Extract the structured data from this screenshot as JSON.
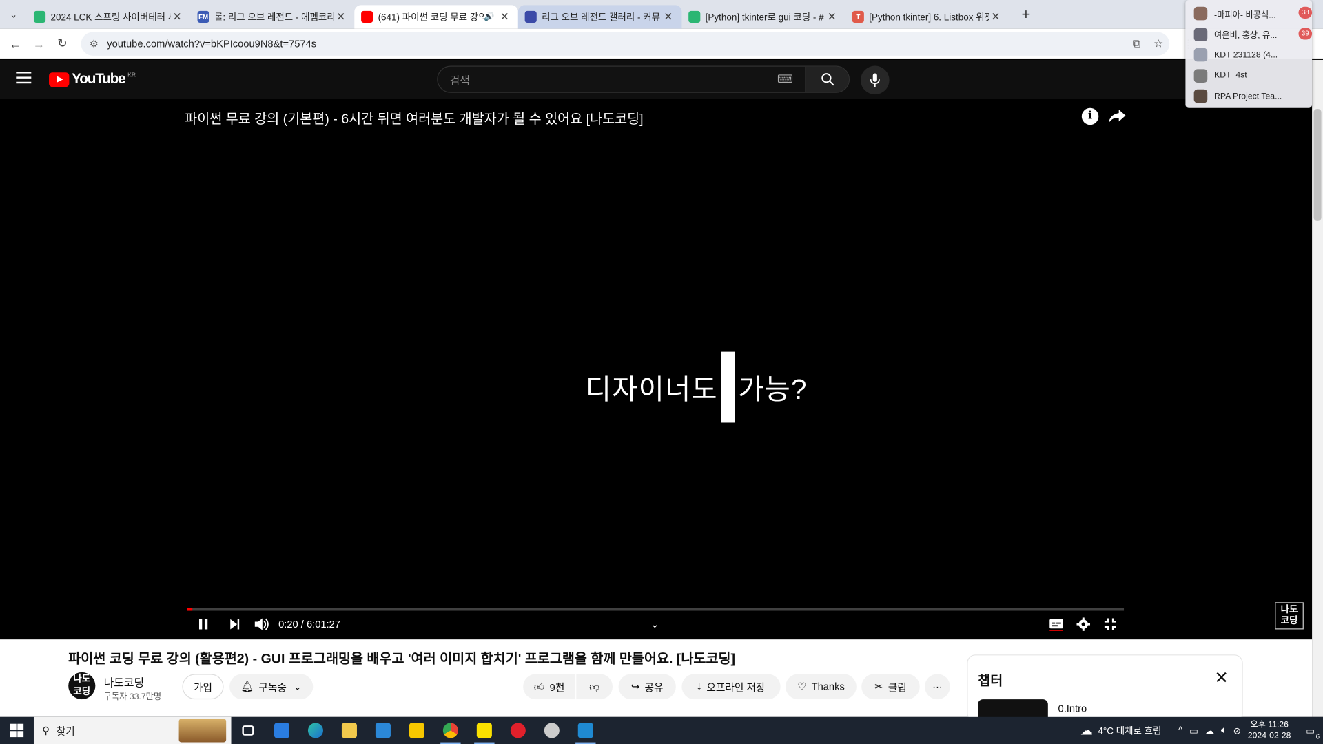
{
  "browser": {
    "tabs": [
      {
        "title": "2024 LCK 스프링 사이버테러 사",
        "favicon_color": "#2bb673",
        "favicon_text": "",
        "active": false
      },
      {
        "title": "롤: 리그 오브 레전드 - 에펨코리",
        "favicon_color": "#3b5bb5",
        "favicon_text": "FM",
        "active": false
      },
      {
        "title": "(641) 파이썬 코딩 무료 강의",
        "favicon_color": "#ff0000",
        "favicon_text": "",
        "active": true,
        "audio": "🔊"
      },
      {
        "title": "리그 오브 레전드 갤러리 - 커뮤",
        "favicon_color": "#3b4aa8",
        "favicon_text": "",
        "active": false,
        "highlight": true
      },
      {
        "title": "[Python] tkinter로 gui 코딩 - #",
        "favicon_color": "#2bb673",
        "favicon_text": "",
        "active": false
      },
      {
        "title": "[Python tkinter] 6. Listbox 위젯",
        "favicon_color": "#e05a4a",
        "favicon_text": "T",
        "active": false
      }
    ],
    "new_tab": "+",
    "url": "youtube.com/watch?v=bKPIcoou9N8&t=7574s"
  },
  "notifications": [
    {
      "name": "-마피아- 비공식...",
      "badge": "38",
      "avatar_color": "#8a6a5e"
    },
    {
      "name": "여은비, 홍상, 유...",
      "badge": "39",
      "avatar_color": "#6a6a78"
    },
    {
      "name": "KDT 231128 (4...",
      "badge": "",
      "avatar_color": "#9aa0b0"
    },
    {
      "name": "KDT_4st",
      "badge": "",
      "avatar_color": "#7a7a7a"
    },
    {
      "name": "RPA Project Tea...",
      "badge": "",
      "avatar_color": "#5a4a40"
    }
  ],
  "youtube": {
    "logo_text": "YouTube",
    "region": "KR",
    "search_placeholder": "검색"
  },
  "player": {
    "title": "파이썬 무료 강의 (기본편) - 6시간 뒤면 여러분도 개발자가 될 수 있어요 [나도코딩]",
    "caption_left": "디자이너도",
    "caption_right": "가능?",
    "time_current": "0:20",
    "time_total": "6:01:27",
    "progress_fraction": 0.005,
    "watermark": "나도\n코딩"
  },
  "video_info": {
    "title": "파이썬 코딩 무료 강의 (활용편2) - GUI 프로그래밍을 배우고 '여러 이미지 합치기' 프로그램을 함께 만들어요. [나도코딩]",
    "channel_name": "나도코딩",
    "subscribers": "구독자 33.7만명",
    "avatar_text": "나도\n코딩",
    "join_label": "가입",
    "subscribed_label": "구독중",
    "like_count": "9천",
    "share_label": "공유",
    "offline_label": "오프라인 저장",
    "thanks_label": "Thanks",
    "clip_label": "클립",
    "more_label": "···"
  },
  "chapters": {
    "title": "챕터",
    "first_item": "0.Intro"
  },
  "taskbar": {
    "search_label": "찾기",
    "weather": "4°C  대체로 흐림",
    "time": "오후 11:26",
    "date": "2024-02-28",
    "notification_count": "6"
  }
}
